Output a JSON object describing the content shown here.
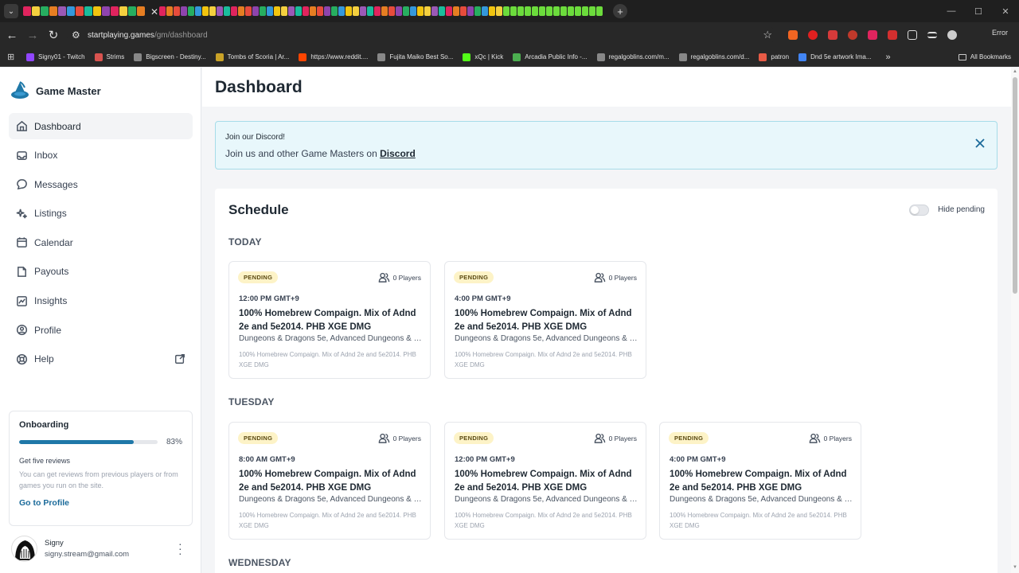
{
  "browser": {
    "url_host": "startplaying.games",
    "url_path": "/gm/dashboard",
    "error_label": "Error",
    "all_bookmarks": "All Bookmarks",
    "bookmarks": [
      {
        "label": "Signy01 - Twitch",
        "color": "#9146ff"
      },
      {
        "label": "Strims",
        "color": "#d9534f"
      },
      {
        "label": "Bigscreen - Destiny...",
        "color": "#888888"
      },
      {
        "label": "Tombs of Scoria | Ar...",
        "color": "#c9a227"
      },
      {
        "label": "https://www.reddit....",
        "color": "#ff4500"
      },
      {
        "label": "Fujita Maiko Best So...",
        "color": "#888888"
      },
      {
        "label": "xQc | Kick",
        "color": "#53fc18"
      },
      {
        "label": "Arcadia Public Info -...",
        "color": "#4caf50"
      },
      {
        "label": "regalgoblins.com/m...",
        "color": "#888888"
      },
      {
        "label": "regalgoblins.com/d...",
        "color": "#888888"
      },
      {
        "label": "patron",
        "color": "#e85b46"
      },
      {
        "label": "Dnd 5e artwork Ima...",
        "color": "#4285f4"
      }
    ],
    "ext_badge": "22"
  },
  "app": {
    "brand": "Game Master",
    "menu": [
      {
        "label": "Dashboard",
        "icon": "home-icon"
      },
      {
        "label": "Inbox",
        "icon": "inbox-icon"
      },
      {
        "label": "Messages",
        "icon": "chat-icon"
      },
      {
        "label": "Listings",
        "icon": "sparkle-icon"
      },
      {
        "label": "Calendar",
        "icon": "calendar-icon"
      },
      {
        "label": "Payouts",
        "icon": "folder-icon"
      },
      {
        "label": "Insights",
        "icon": "chart-icon"
      },
      {
        "label": "Profile",
        "icon": "user-circle-icon"
      },
      {
        "label": "Help",
        "icon": "lifebuoy-icon"
      }
    ],
    "onboarding": {
      "title": "Onboarding",
      "percent_label": "83%",
      "percent_value": 0.83,
      "task": "Get five reviews",
      "desc": "You can get reviews from previous players or from games you run on the site.",
      "link": "Go to Profile"
    },
    "user": {
      "name": "Signy",
      "email": "signy.stream@gmail.com"
    }
  },
  "main": {
    "title": "Dashboard",
    "discord": {
      "title": "Join our Discord!",
      "text": "Join us and other Game Masters on ",
      "link": "Discord"
    },
    "schedule": {
      "title": "Schedule",
      "toggle_label": "Hide pending",
      "days": [
        {
          "label": "TODAY",
          "games": [
            {
              "status": "PENDING",
              "players": "0 Players",
              "time": "12:00 PM GMT+9",
              "title": "100% Homebrew Compaign. Mix of Adnd 2e and 5e2014. PHB XGE DMG",
              "systems": "Dungeons & Dragons 5e, Advanced Dungeons & Dragons 2e",
              "desc": "100% Homebrew Compaign. Mix of Adnd 2e and 5e2014. PHB XGE DMG"
            },
            {
              "status": "PENDING",
              "players": "0 Players",
              "time": "4:00 PM GMT+9",
              "title": "100% Homebrew Compaign. Mix of Adnd 2e and 5e2014. PHB XGE DMG",
              "systems": "Dungeons & Dragons 5e, Advanced Dungeons & Dragons 2e",
              "desc": "100% Homebrew Compaign. Mix of Adnd 2e and 5e2014. PHB XGE DMG"
            }
          ]
        },
        {
          "label": "TUESDAY",
          "games": [
            {
              "status": "PENDING",
              "players": "0 Players",
              "time": "8:00 AM GMT+9",
              "title": "100% Homebrew Compaign. Mix of Adnd 2e and 5e2014. PHB XGE DMG",
              "systems": "Dungeons & Dragons 5e, Advanced Dungeons & Dragons 2e",
              "desc": "100% Homebrew Compaign. Mix of Adnd 2e and 5e2014. PHB XGE DMG"
            },
            {
              "status": "PENDING",
              "players": "0 Players",
              "time": "12:00 PM GMT+9",
              "title": "100% Homebrew Compaign. Mix of Adnd 2e and 5e2014. PHB XGE DMG",
              "systems": "Dungeons & Dragons 5e, Advanced Dungeons & Dragons 2e",
              "desc": "100% Homebrew Compaign. Mix of Adnd 2e and 5e2014. PHB XGE DMG"
            },
            {
              "status": "PENDING",
              "players": "0 Players",
              "time": "4:00 PM GMT+9",
              "title": "100% Homebrew Compaign. Mix of Adnd 2e and 5e2014. PHB XGE DMG",
              "systems": "Dungeons & Dragons 5e, Advanced Dungeons & Dragons 2e",
              "desc": "100% Homebrew Compaign. Mix of Adnd 2e and 5e2014. PHB XGE DMG"
            }
          ]
        },
        {
          "label": "WEDNESDAY",
          "games": []
        }
      ]
    }
  },
  "colors": {
    "accent": "#1f78a8",
    "pending_bg": "#fdf3c7",
    "discord_bg": "#e8f7fb"
  }
}
